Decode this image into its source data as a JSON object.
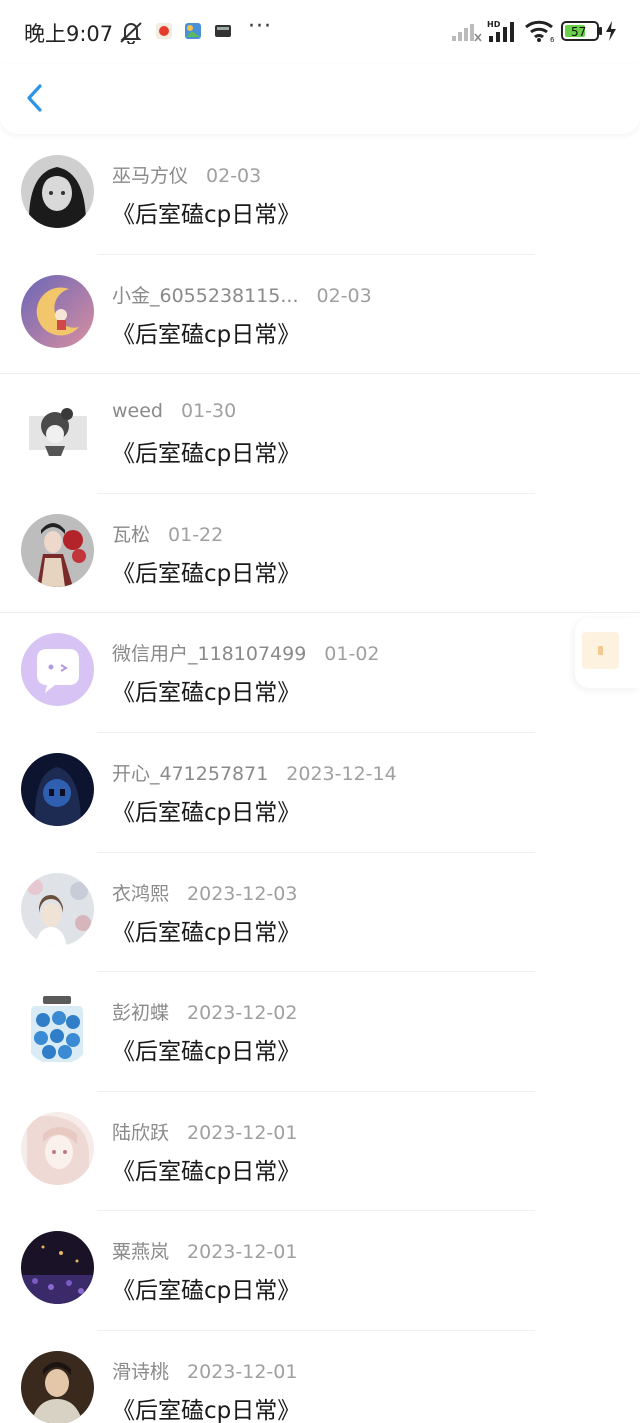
{
  "status_bar": {
    "time": "晚上9:07",
    "more": "···",
    "battery": "57"
  },
  "nav": {
    "back_icon": "chevron-left-icon"
  },
  "float_button": {
    "icon": "gift-icon"
  },
  "items": [
    {
      "name": "巫马方仪",
      "date": "02-03",
      "title": "《后室磕cp日常》"
    },
    {
      "name": "小金_6055238115...",
      "date": "02-03",
      "title": "《后室磕cp日常》"
    },
    {
      "name": "weed",
      "date": "01-30",
      "title": "《后室磕cp日常》"
    },
    {
      "name": "瓦松",
      "date": "01-22",
      "title": "《后室磕cp日常》"
    },
    {
      "name": "微信用户_118107499",
      "date": "01-02",
      "title": "《后室磕cp日常》"
    },
    {
      "name": "开心_471257871",
      "date": "2023-12-14",
      "title": "《后室磕cp日常》"
    },
    {
      "name": "衣鸿熙",
      "date": "2023-12-03",
      "title": "《后室磕cp日常》"
    },
    {
      "name": "彭初蝶",
      "date": "2023-12-02",
      "title": "《后室磕cp日常》"
    },
    {
      "name": "陆欣跃",
      "date": "2023-12-01",
      "title": "《后室磕cp日常》"
    },
    {
      "name": "粟燕岚",
      "date": "2023-12-01",
      "title": "《后室磕cp日常》"
    },
    {
      "name": "滑诗桃",
      "date": "2023-12-01",
      "title": "《后室磕cp日常》"
    }
  ]
}
